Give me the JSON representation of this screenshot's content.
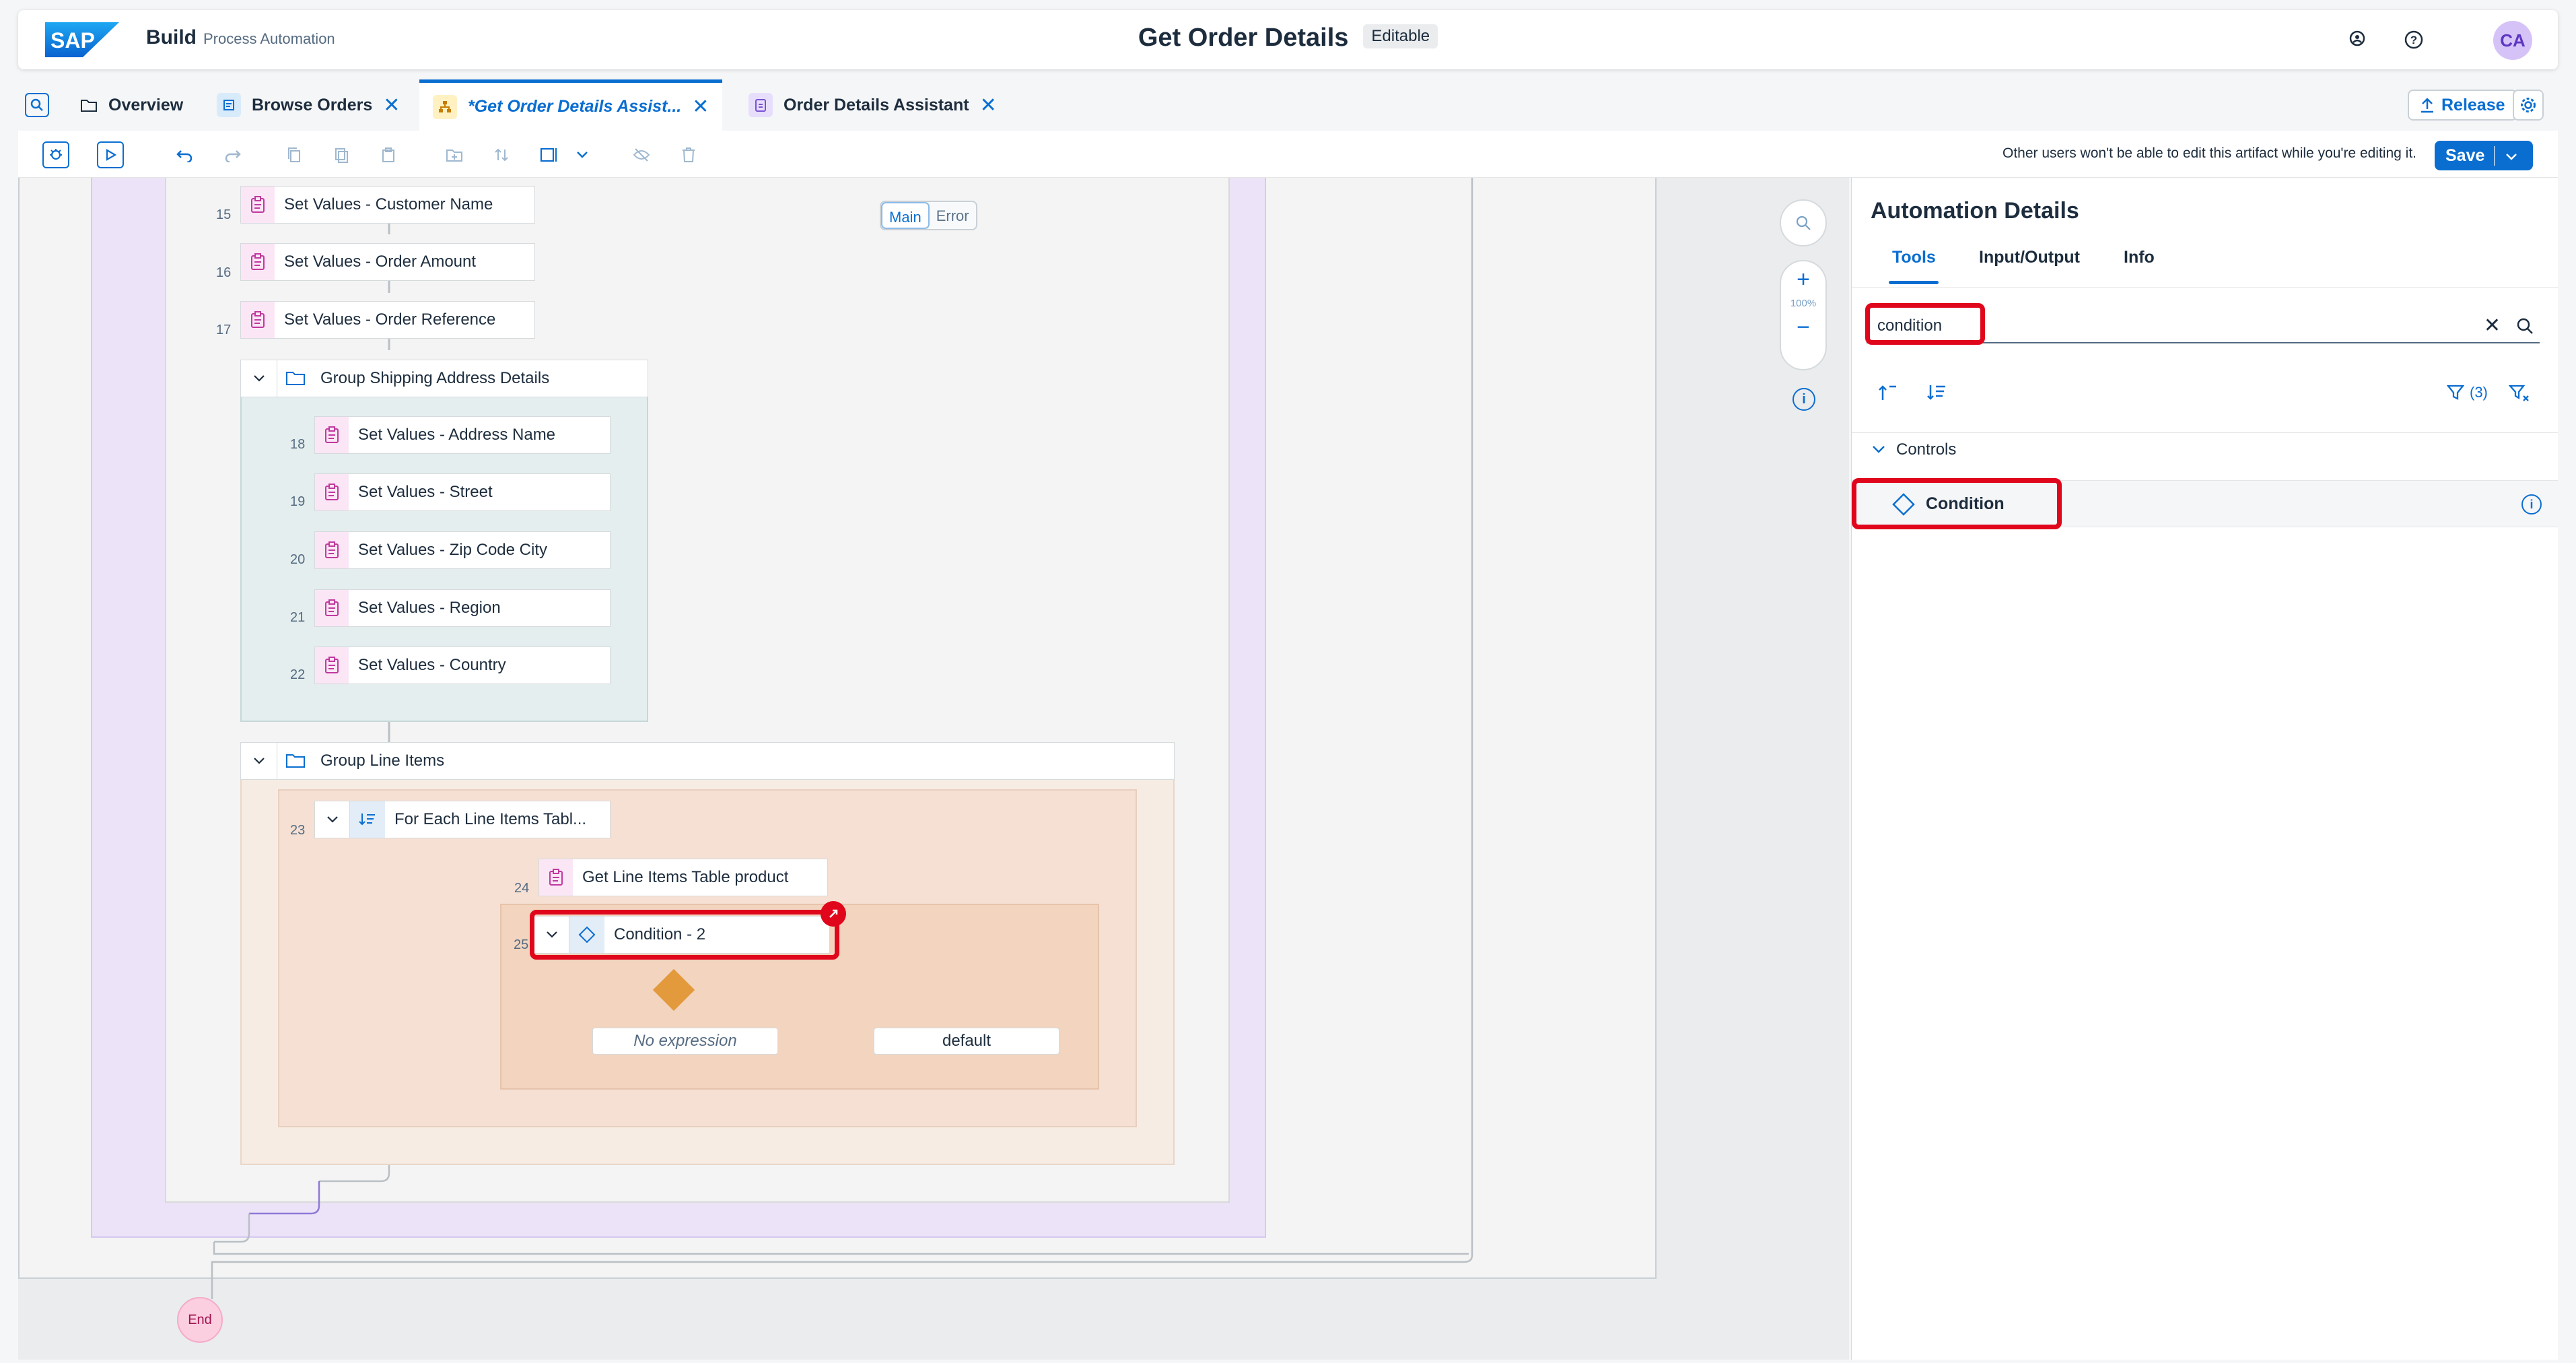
{
  "shell": {
    "product": "Build",
    "subtitle": "Process Automation",
    "title": "Get Order Details",
    "badge": "Editable",
    "avatar": "CA"
  },
  "tabs": [
    {
      "label": "Overview"
    },
    {
      "label": "Browse Orders"
    },
    {
      "label": "*Get Order Details Assist..."
    },
    {
      "label": "Order Details Assistant"
    }
  ],
  "release_label": "Release",
  "toolbar": {
    "notice": "Other users won't be able to edit this artifact while you're editing it.",
    "save_label": "Save"
  },
  "canvas": {
    "main_label": "Main",
    "error_label": "Error",
    "zoom": "100%",
    "steps": [
      {
        "num": "15",
        "label": "Set Values - Customer Name"
      },
      {
        "num": "16",
        "label": "Set Values - Order Amount"
      },
      {
        "num": "17",
        "label": "Set Values - Order Reference"
      },
      {
        "num": "18",
        "label": "Set Values - Address Name"
      },
      {
        "num": "19",
        "label": "Set Values - Street"
      },
      {
        "num": "20",
        "label": "Set Values - Zip Code City"
      },
      {
        "num": "21",
        "label": "Set Values - Region"
      },
      {
        "num": "22",
        "label": "Set Values - Country"
      },
      {
        "num": "23",
        "label": "For Each Line Items Tabl..."
      },
      {
        "num": "24",
        "label": "Get Line Items Table product"
      },
      {
        "num": "25",
        "label": "Condition - 2"
      }
    ],
    "group_shipping": "Group Shipping Address Details",
    "group_line_items": "Group Line Items",
    "branch_no_expr": "No expression",
    "branch_default": "default",
    "end_label": "End"
  },
  "panel": {
    "title": "Automation Details",
    "tabs": [
      "Tools",
      "Input/Output",
      "Info"
    ],
    "search_value": "condition",
    "filter_count": "(3)",
    "section": "Controls",
    "result": "Condition"
  },
  "colors": {
    "accent": "#0a6ed1",
    "highlight": "#e0061b",
    "pink": "#c0399f",
    "orange": "#e9a55a",
    "teal": "#4fa3a1",
    "purple": "#8f7ad6"
  }
}
